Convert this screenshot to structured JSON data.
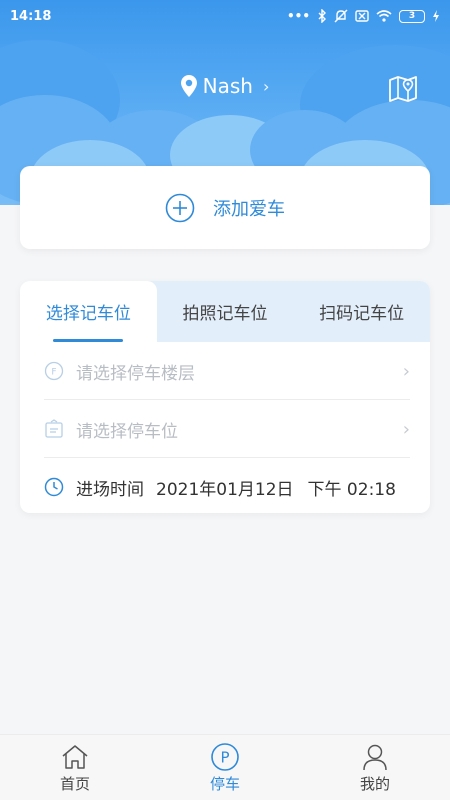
{
  "status_bar": {
    "time": "14:18",
    "battery": "3"
  },
  "header": {
    "location": "Nash"
  },
  "add_car": {
    "label": "添加爱车"
  },
  "record": {
    "tabs": [
      {
        "label": "选择记车位"
      },
      {
        "label": "拍照记车位"
      },
      {
        "label": "扫码记车位"
      }
    ],
    "floor_placeholder": "请选择停车楼层",
    "spot_placeholder": "请选择停车位",
    "entry_label": "进场时间",
    "entry_date": "2021年01月12日",
    "entry_time": "下午 02:18"
  },
  "bottom_nav": [
    {
      "label": "首页"
    },
    {
      "label": "停车"
    },
    {
      "label": "我的"
    }
  ],
  "colors": {
    "accent": "#2f8ad8",
    "sky": "#3b97ec"
  }
}
